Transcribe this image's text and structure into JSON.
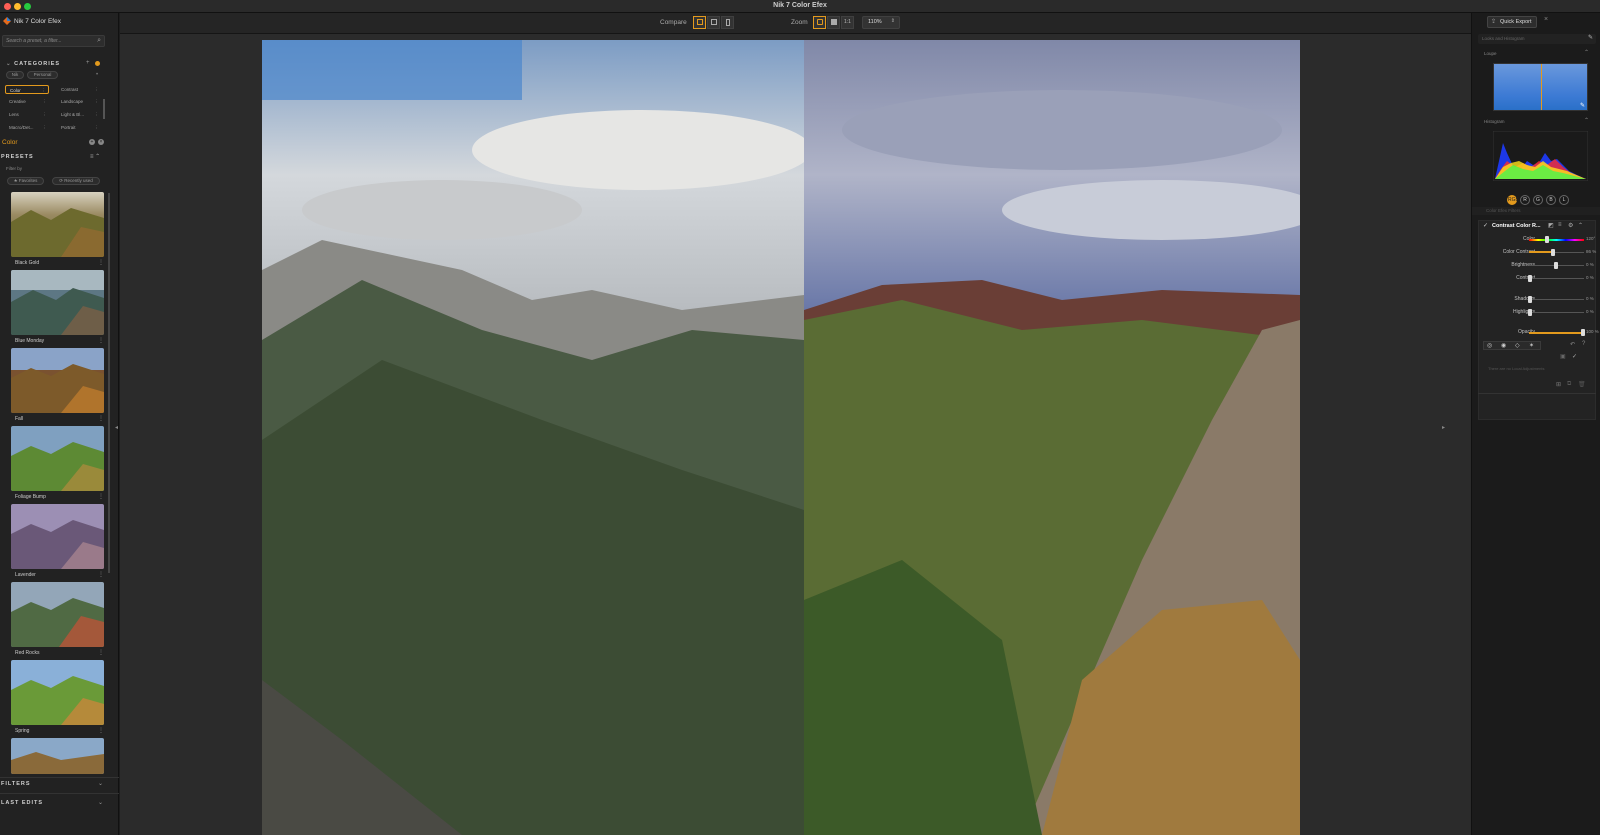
{
  "window": {
    "title": "Nik 7 Color Efex"
  },
  "left": {
    "app_name": "Nik 7 Color Efex",
    "search_placeholder": "Search a preset, a filter...",
    "categories_title": "CATEGORIES",
    "tabs": [
      "Nik",
      "Personal"
    ],
    "categories": [
      [
        "Color",
        "Contrast"
      ],
      [
        "Creative",
        "Landscape"
      ],
      [
        "Lens",
        "Light & Bl..."
      ],
      [
        "Macro/Det...",
        "Portrait"
      ]
    ],
    "active_category_label": "Color",
    "presets_title": "PRESETS",
    "filter_by": "Filter by",
    "filter_favorites": "★ Favorites",
    "filter_recent": "⟳ Recently used",
    "presets": [
      "Black Gold",
      "Blue Monday",
      "Fall",
      "Foliage Bump",
      "Lavender",
      "Red Rocks",
      "Spring"
    ],
    "filters_title": "FILTERS",
    "last_edits_title": "LAST EDITS"
  },
  "topbar": {
    "compare_label": "Compare",
    "zoom_label": "Zoom",
    "zoom_fit": "1:1",
    "zoom_value": "110%"
  },
  "right": {
    "quick_export": "Quick Export",
    "looks_title": "Looks and Histogram",
    "loupe_title": "Loupe",
    "histogram_title": "Histogram",
    "hist_channels": [
      "RGB",
      "R",
      "G",
      "B",
      "L"
    ],
    "filters_title": "Color Efex Filters",
    "filter_name": "Contrast Color R...",
    "sliders": [
      {
        "label": "Color",
        "value": "120°",
        "level": 0.33
      },
      {
        "label": "Color Contrast",
        "value": "86 %",
        "level": 0.43
      },
      {
        "label": "Brightness",
        "value": "0 %",
        "level": 0.5
      },
      {
        "label": "Contrast",
        "value": "0 %",
        "level": 0.0
      },
      {
        "label": "Shadows",
        "value": "0 %",
        "level": 0.0
      },
      {
        "label": "Highlights",
        "value": "0 %",
        "level": 0.0
      },
      {
        "label": "Opacity",
        "value": "100 %",
        "level": 1.0
      }
    ],
    "no_local": "There are no Local Adjustments"
  },
  "colors": {
    "accent": "#e39a1d",
    "panel": "#222222",
    "canvas": "#2b2b2b"
  }
}
